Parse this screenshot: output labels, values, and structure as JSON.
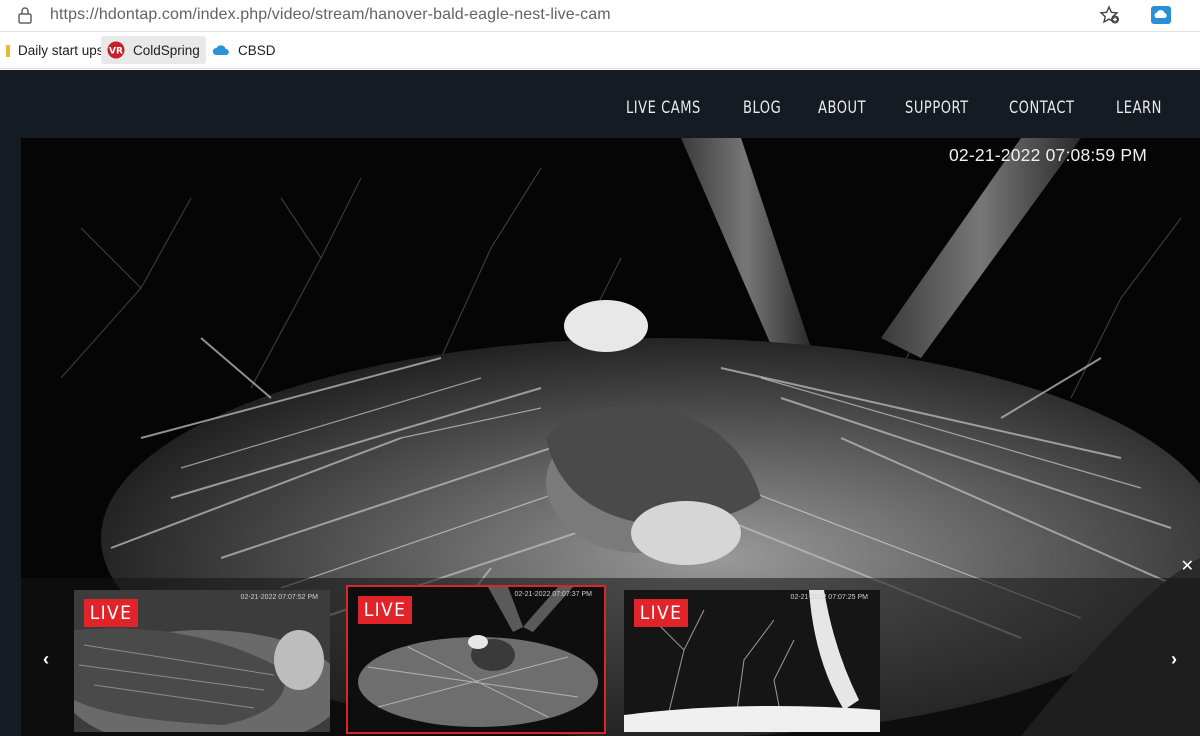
{
  "browser": {
    "url": "https://hdontap.com/index.php/video/stream/hanover-bald-eagle-nest-live-cam",
    "icons": {
      "lock": "lock-icon",
      "favorite": "add-favorite-icon",
      "extension": "cloud-extension-icon"
    }
  },
  "bookmarks": [
    {
      "label": "Daily start ups",
      "icon": "folder-icon"
    },
    {
      "label": "ColdSpring",
      "icon": "vr-logo-icon"
    },
    {
      "label": "CBSD",
      "icon": "cloud-icon"
    }
  ],
  "nav": {
    "items": [
      "LIVE CAMS",
      "BLOG",
      "ABOUT",
      "SUPPORT",
      "CONTACT",
      "LEARN"
    ]
  },
  "player": {
    "timestamp": "02-21-2022 07:08:59 PM",
    "close_label": "✕",
    "prev_label": "‹",
    "next_label": "›"
  },
  "thumbnails": [
    {
      "badge": "LIVE",
      "time": "02-21-2022 07:07:52 PM",
      "selected": false
    },
    {
      "badge": "LIVE",
      "time": "02-21-2022 07:07:37 PM",
      "selected": true
    },
    {
      "badge": "LIVE",
      "time": "02-21-2022 07:07:25 PM",
      "selected": false
    }
  ],
  "colors": {
    "site_bg": "#151b22",
    "live_red": "#e0242a",
    "nav_text": "#e9eaec"
  }
}
